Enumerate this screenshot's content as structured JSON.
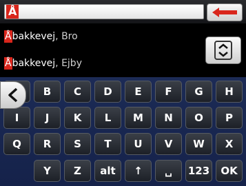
{
  "search": {
    "value": "Å"
  },
  "results": [
    {
      "highlight": "Å",
      "rest": "bakkevej",
      "suffix": ", Bro"
    },
    {
      "highlight": "Å",
      "rest": "bakkevej",
      "suffix": ", Ejby"
    }
  ],
  "keyboard": {
    "rows": [
      [
        "A",
        "B",
        "C",
        "D",
        "E",
        "F",
        "G",
        "H"
      ],
      [
        "I",
        "J",
        "K",
        "L",
        "M",
        "N",
        "O",
        "P"
      ],
      [
        "Q",
        "R",
        "S",
        "T",
        "U",
        "V",
        "W",
        "X"
      ]
    ],
    "bottom": [
      "Y",
      "Z",
      "alt",
      "↑",
      "␣",
      "123",
      "OK"
    ]
  },
  "colors": {
    "accent": "#d9261c",
    "keyboard_bg": "#1a2850",
    "key_bg": "#2b2f36"
  },
  "icons": {
    "backspace": "red-left-arrow-icon",
    "scroll": "chevron-up-down-icon",
    "back": "chevron-left-icon"
  }
}
